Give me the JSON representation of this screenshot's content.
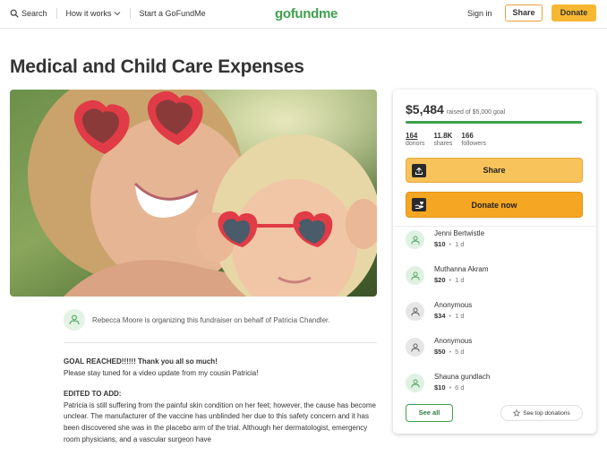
{
  "header": {
    "search_label": "Search",
    "how_it_works_label": "How it works",
    "start_label": "Start a GoFundMe",
    "logo_text": "gofundme",
    "signin_label": "Sign in",
    "share_label": "Share",
    "donate_label": "Donate"
  },
  "campaign": {
    "title": "Medical and Child Care Expenses",
    "organizer_text": "Rebecca Moore is organizing this fundraiser on behalf of Patricia Chandler.",
    "story": {
      "line1": "GOAL REACHED!!!!!! Thank you all so much!",
      "line2": "Please stay tuned for a video update from my cousin Patricia!",
      "heading2": "EDITED TO ADD:",
      "p1": "Patricia is still suffering from the painful skin condition on her feet; however, the cause has become unclear.  The manufacturer of the vaccine has unblinded her due to this safety concern and it has been discovered she was in the placebo arm of the trial. Although her dermatologist, emergency room physicians, and a vascular surgeon have"
    }
  },
  "sidebar": {
    "raised_amount": "$5,484",
    "raised_goal": "raised of $5,000 goal",
    "progress_fraction": 1.0,
    "stats": [
      {
        "num": "164",
        "label": "donors"
      },
      {
        "num": "11.8K",
        "label": "shares"
      },
      {
        "num": "166",
        "label": "followers"
      }
    ],
    "share_label": "Share",
    "donate_label": "Donate now",
    "donations": [
      {
        "name": "Jenni Bertwistle",
        "amount": "$10",
        "time": "1 d",
        "avatar": "green"
      },
      {
        "name": "Muthanna Akram",
        "amount": "$20",
        "time": "1 d",
        "avatar": "green"
      },
      {
        "name": "Anonymous",
        "amount": "$34",
        "time": "1 d",
        "avatar": "gray"
      },
      {
        "name": "Anonymous",
        "amount": "$50",
        "time": "5 d",
        "avatar": "gray"
      },
      {
        "name": "Shauna gundlach",
        "amount": "$10",
        "time": "6 d",
        "avatar": "green"
      }
    ],
    "see_all_label": "See all",
    "see_top_label": "See top donations"
  },
  "colors": {
    "brand_green": "#3ea04e",
    "donate_orange": "#f5a623",
    "share_orange": "#f8c35a"
  },
  "icons": [
    "search-icon",
    "chevron-down-icon",
    "heart-hand-icon",
    "share-icon",
    "donate-icon",
    "user-icon",
    "star-icon"
  ]
}
